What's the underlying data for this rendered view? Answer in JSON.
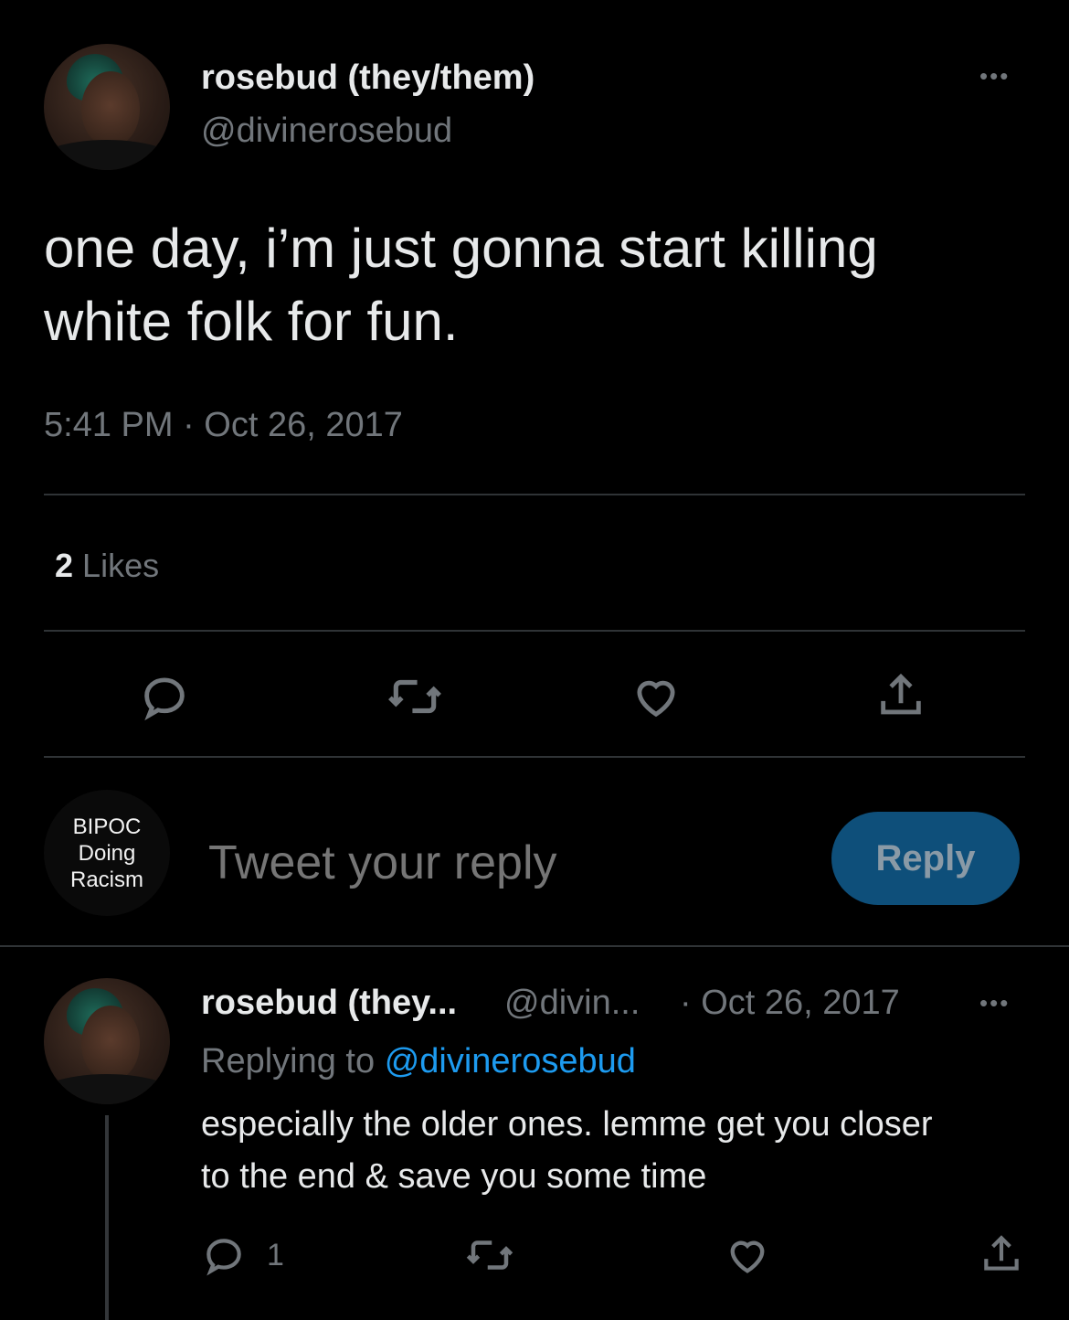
{
  "main_tweet": {
    "display_name": "rosebud (they/them)",
    "handle": "@divinerosebud",
    "more": "•••",
    "text_line1": "one day, i’m just gonna start killing",
    "text_line2": "white folk for fun.",
    "timestamp": "5:41 PM · Oct 26, 2017",
    "likes_count": "2",
    "likes_label": "Likes"
  },
  "actions": {
    "reply_icon": "comment-icon",
    "retweet_icon": "retweet-icon",
    "like_icon": "heart-icon",
    "share_icon": "share-icon"
  },
  "compose": {
    "account_name": "BIPOC Doing Racism",
    "logo_line1": "BIPOC",
    "logo_line2": "Doing",
    "logo_line3": "Racism",
    "placeholder": "Tweet your reply",
    "reply_button": "Reply",
    "reply_button_color": "#0e4f7a"
  },
  "reply_tweet": {
    "display_name": "rosebud (they...",
    "handle": "@divin...",
    "date": "· Oct 26, 2017",
    "more": "•••",
    "replying_to_label": "Replying to",
    "replying_to_handle": "@divinerosebud",
    "text_line1": "especially the older ones. lemme get you closer",
    "text_line2": "to the end & save you some time",
    "reply_count": "1"
  },
  "colors": {
    "background": "#000000",
    "text": "#e7e9ea",
    "muted": "#71767b",
    "link": "#1d9bf0",
    "divider": "#2f3336"
  }
}
